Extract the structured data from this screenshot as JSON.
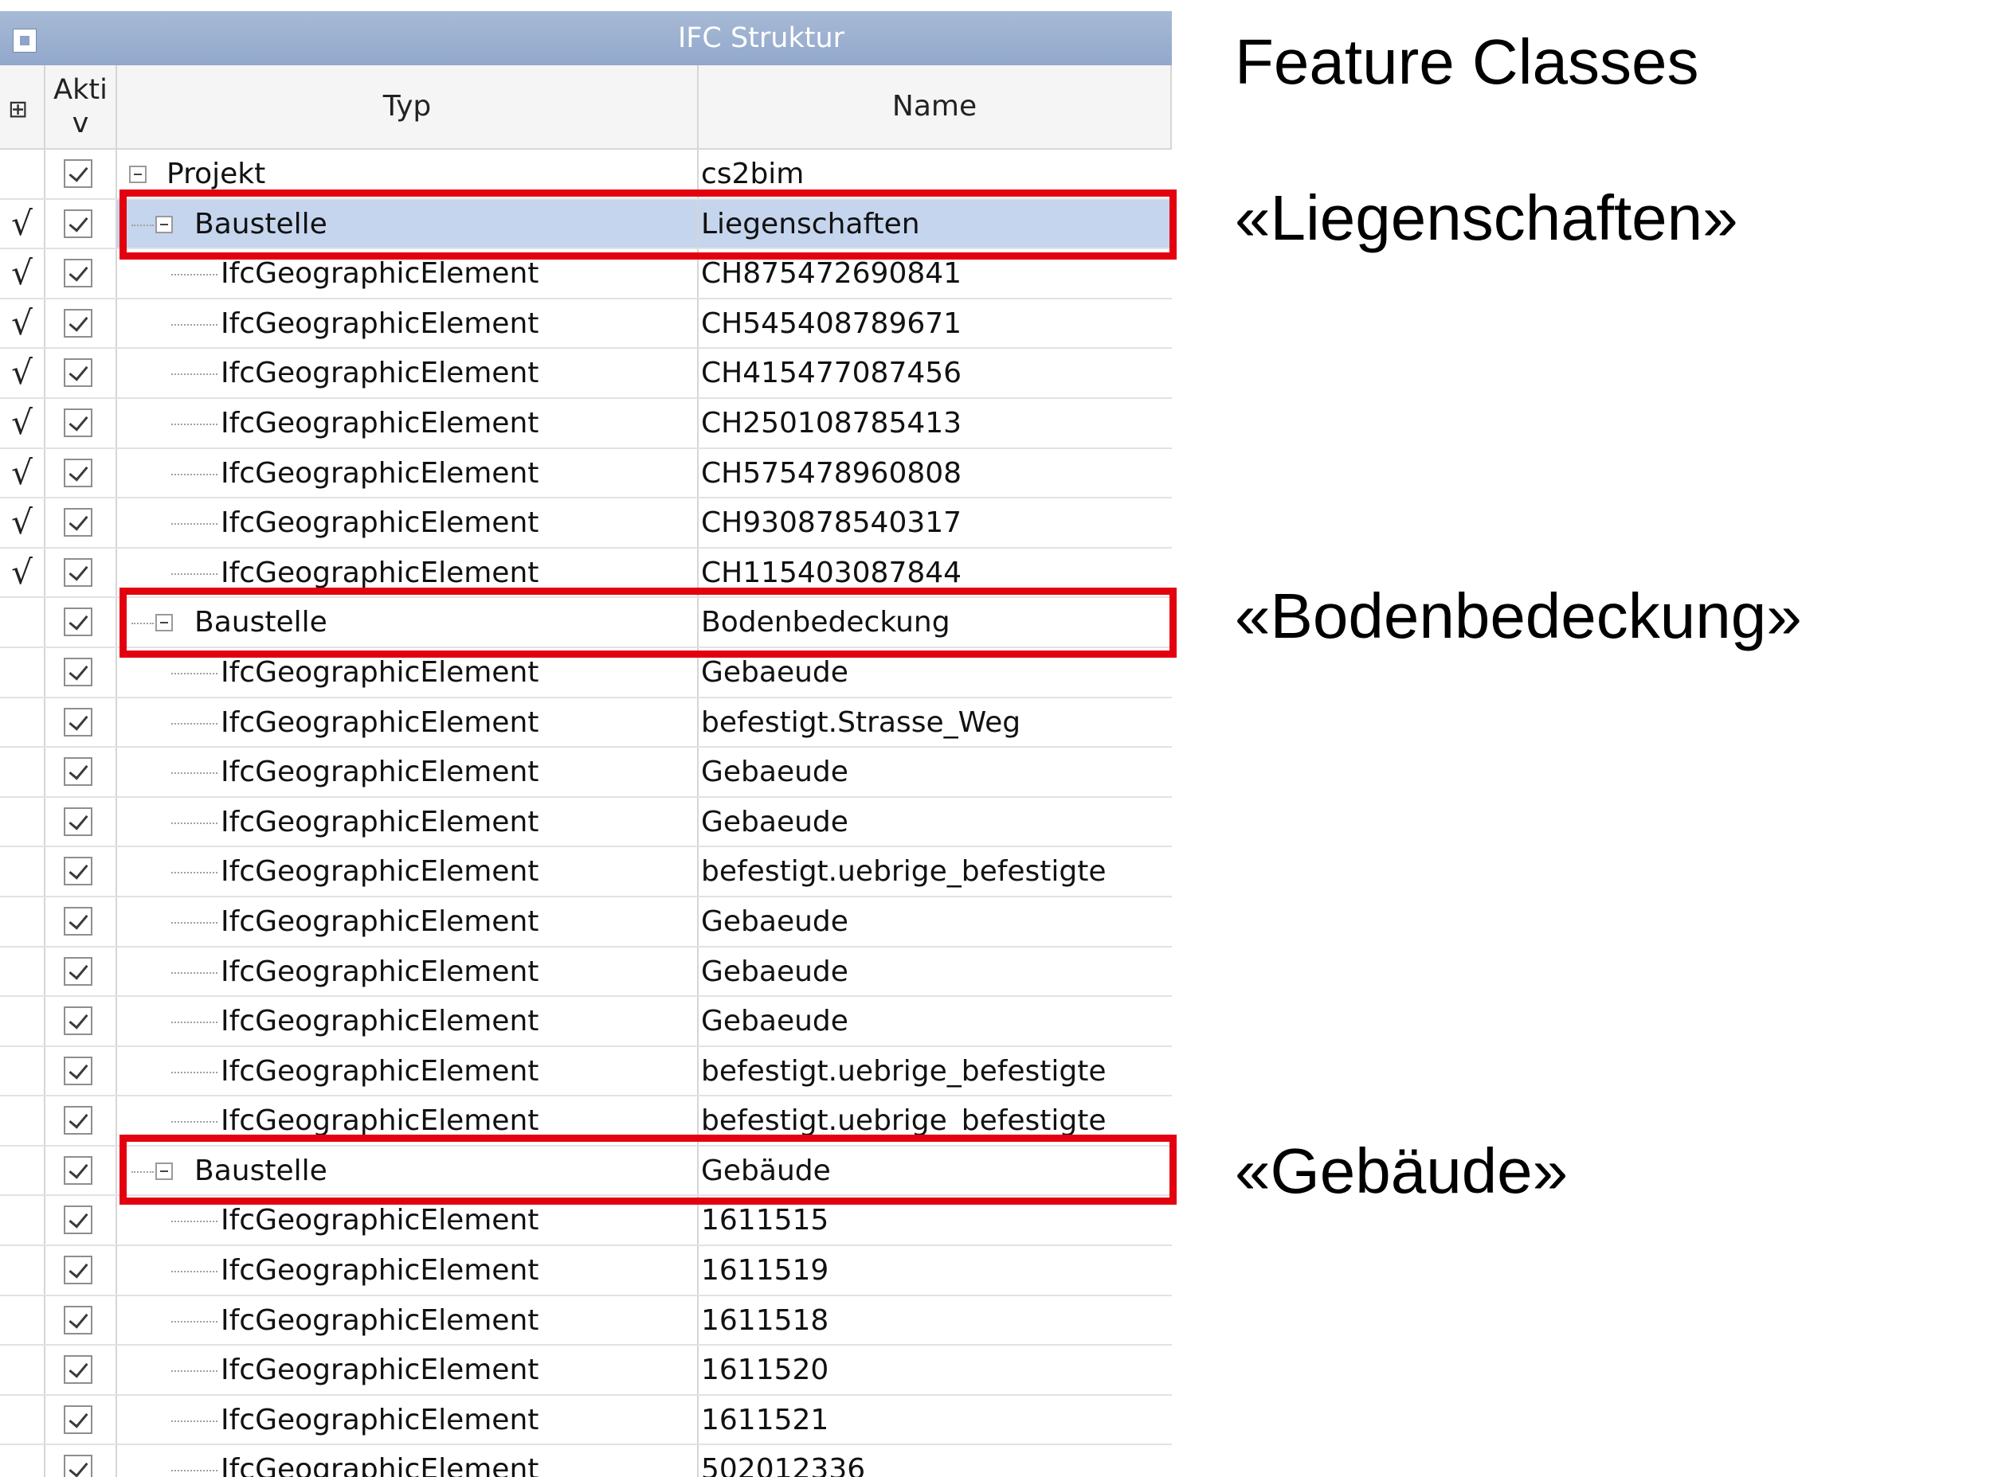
{
  "window": {
    "title": "IFC Struktur"
  },
  "columns": {
    "aktiv": "Akti\nv",
    "typ": "Typ",
    "name": "Name"
  },
  "header_icons": {
    "filter": "table-filter-icon"
  },
  "rows": [
    {
      "typ": "Projekt",
      "name": "cs2bim",
      "level": 0,
      "mark": "",
      "checked": true,
      "expander": true
    },
    {
      "typ": "Baustelle",
      "name": "Liegenschaften",
      "level": 1,
      "mark": "√",
      "checked": true,
      "expander": true,
      "selected": true
    },
    {
      "typ": "IfcGeographicElement",
      "name": "CH875472690841",
      "level": 2,
      "mark": "√",
      "checked": true
    },
    {
      "typ": "IfcGeographicElement",
      "name": "CH545408789671",
      "level": 2,
      "mark": "√",
      "checked": true
    },
    {
      "typ": "IfcGeographicElement",
      "name": "CH415477087456",
      "level": 2,
      "mark": "√",
      "checked": true
    },
    {
      "typ": "IfcGeographicElement",
      "name": "CH250108785413",
      "level": 2,
      "mark": "√",
      "checked": true
    },
    {
      "typ": "IfcGeographicElement",
      "name": "CH575478960808",
      "level": 2,
      "mark": "√",
      "checked": true
    },
    {
      "typ": "IfcGeographicElement",
      "name": "CH930878540317",
      "level": 2,
      "mark": "√",
      "checked": true
    },
    {
      "typ": "IfcGeographicElement",
      "name": "CH115403087844",
      "level": 2,
      "mark": "√",
      "checked": true
    },
    {
      "typ": "Baustelle",
      "name": "Bodenbedeckung",
      "level": 1,
      "mark": "",
      "checked": true,
      "expander": true
    },
    {
      "typ": "IfcGeographicElement",
      "name": "Gebaeude",
      "level": 2,
      "mark": "",
      "checked": true
    },
    {
      "typ": "IfcGeographicElement",
      "name": "befestigt.Strasse_Weg",
      "level": 2,
      "mark": "",
      "checked": true
    },
    {
      "typ": "IfcGeographicElement",
      "name": "Gebaeude",
      "level": 2,
      "mark": "",
      "checked": true
    },
    {
      "typ": "IfcGeographicElement",
      "name": "Gebaeude",
      "level": 2,
      "mark": "",
      "checked": true
    },
    {
      "typ": "IfcGeographicElement",
      "name": "befestigt.uebrige_befestigte",
      "level": 2,
      "mark": "",
      "checked": true
    },
    {
      "typ": "IfcGeographicElement",
      "name": "Gebaeude",
      "level": 2,
      "mark": "",
      "checked": true
    },
    {
      "typ": "IfcGeographicElement",
      "name": "Gebaeude",
      "level": 2,
      "mark": "",
      "checked": true
    },
    {
      "typ": "IfcGeographicElement",
      "name": "Gebaeude",
      "level": 2,
      "mark": "",
      "checked": true
    },
    {
      "typ": "IfcGeographicElement",
      "name": "befestigt.uebrige_befestigte",
      "level": 2,
      "mark": "",
      "checked": true
    },
    {
      "typ": "IfcGeographicElement",
      "name": "befestigt.uebrige_befestigte",
      "level": 2,
      "mark": "",
      "checked": true
    },
    {
      "typ": "Baustelle",
      "name": "Gebäude",
      "level": 1,
      "mark": "",
      "checked": true,
      "expander": true
    },
    {
      "typ": "IfcGeographicElement",
      "name": "1611515",
      "level": 2,
      "mark": "",
      "checked": true
    },
    {
      "typ": "IfcGeographicElement",
      "name": "1611519",
      "level": 2,
      "mark": "",
      "checked": true
    },
    {
      "typ": "IfcGeographicElement",
      "name": "1611518",
      "level": 2,
      "mark": "",
      "checked": true
    },
    {
      "typ": "IfcGeographicElement",
      "name": "1611520",
      "level": 2,
      "mark": "",
      "checked": true
    },
    {
      "typ": "IfcGeographicElement",
      "name": "1611521",
      "level": 2,
      "mark": "",
      "checked": true
    },
    {
      "typ": "IfcGeographicElement",
      "name": "502012336",
      "level": 2,
      "mark": "",
      "checked": true
    }
  ],
  "captions": {
    "heading": "Feature Classes",
    "liegenschaften": "«Liegenschaften»",
    "bodenbedeckung": "«Bodenbedeckung»",
    "gebaeude": "«Gebäude»"
  },
  "colors": {
    "highlight": "#e3000f",
    "titlebar": "#92a8cb",
    "selection": "#c5d5ee"
  }
}
